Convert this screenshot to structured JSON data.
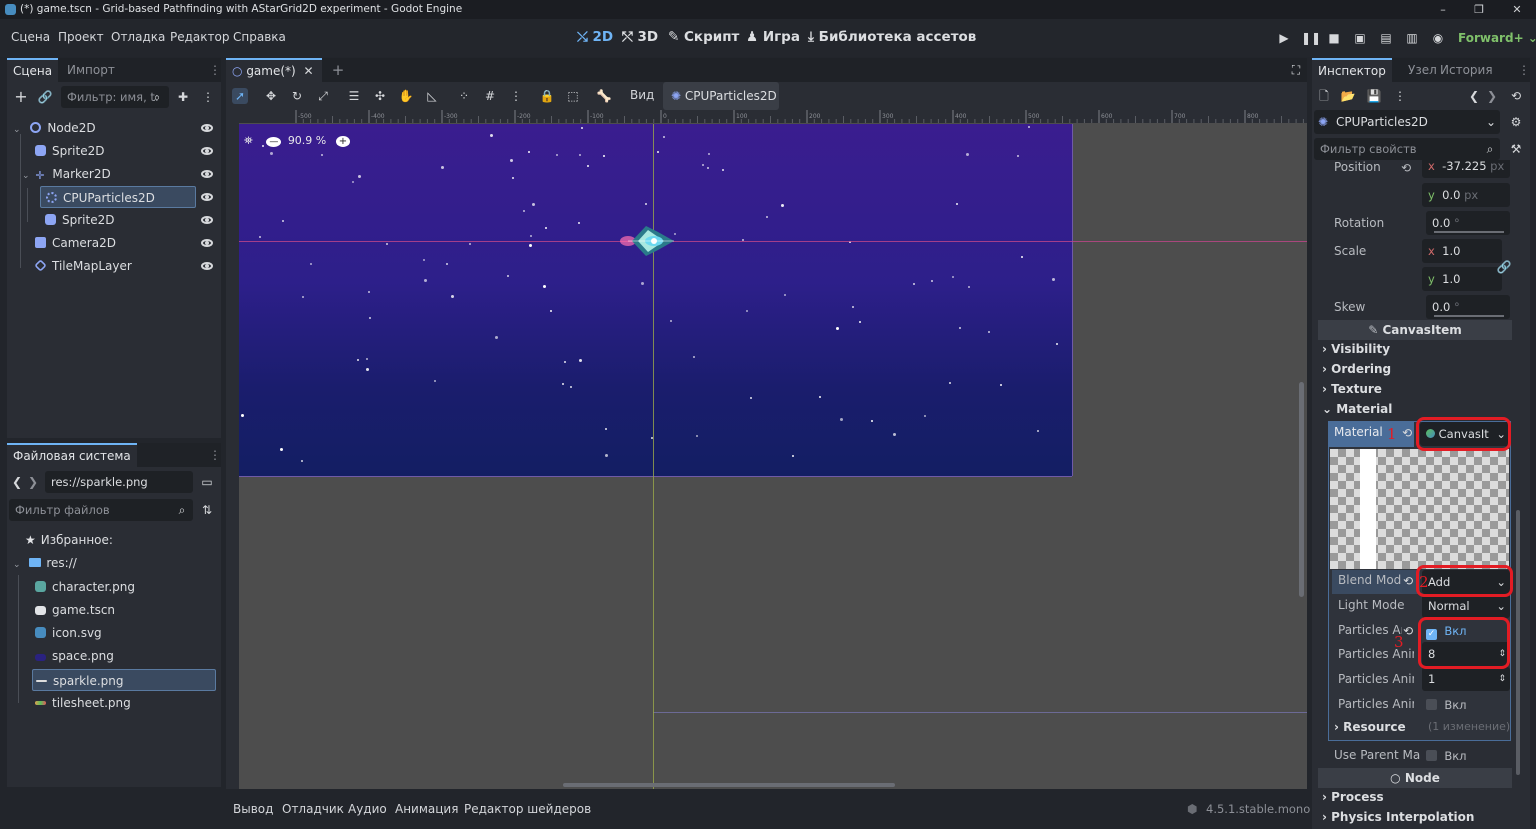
{
  "window": {
    "title": "(*) game.tscn - Grid-based Pathfinding with AStarGrid2D experiment - Godot Engine",
    "controls": [
      "–",
      "❐",
      "✕"
    ]
  },
  "menu": [
    "Сцена",
    "Проект",
    "Отладка",
    "Редактор",
    "Справка"
  ],
  "workspaces": {
    "w2d": "2D",
    "w3d": "3D",
    "script": "Скрипт",
    "game": "Игра",
    "assetlib": "Библиотека ассетов"
  },
  "renderer": "Forward+",
  "scene_dock": {
    "tabs": [
      "Сцена",
      "Импорт"
    ],
    "filter_placeholder": "Фильтр: имя, t:",
    "nodes": [
      {
        "name": "Node2D",
        "color": "#d6d8db"
      },
      {
        "name": "Sprite2D",
        "color": "#8da5f3"
      },
      {
        "name": "Marker2D",
        "color": "#8da5f3"
      },
      {
        "name": "CPUParticles2D",
        "color": "#8da5f3"
      },
      {
        "name": "Sprite2D",
        "color": "#8da5f3"
      },
      {
        "name": "Camera2D",
        "color": "#8da5f3"
      },
      {
        "name": "TileMapLayer",
        "color": "#8da5f3"
      }
    ]
  },
  "fs_dock": {
    "tab": "Файловая система",
    "path": "res://sparkle.png",
    "filter_placeholder": "Фильтр файлов",
    "favorites": "Избранное:",
    "root": "res://",
    "files": [
      "character.png",
      "game.tscn",
      "icon.svg",
      "space.png",
      "sparkle.png",
      "tilesheet.png"
    ]
  },
  "editor": {
    "scene_tab": "game(*)",
    "view_menu": "Вид",
    "context_node": "CPUParticles2D",
    "zoom": "90.9 %",
    "ruler_labels": [
      "-500",
      "-400",
      "-300",
      "-200",
      "-100",
      "0",
      "100",
      "200",
      "300",
      "400",
      "500",
      "600",
      "700",
      "800"
    ]
  },
  "bottom_panel": {
    "tabs": [
      "Вывод",
      "Отладчик",
      "Аудио",
      "Анимация",
      "Редактор шейдеров"
    ],
    "version": "4.5.1.stable.mono"
  },
  "inspector": {
    "tabs": [
      "Инспектор",
      "Узел",
      "История"
    ],
    "node": "CPUParticles2D",
    "filter_placeholder": "Фильтр свойств",
    "position": {
      "label": "Position",
      "x": "-37.225",
      "y": "0.0",
      "unit": "px"
    },
    "rotation": {
      "label": "Rotation",
      "value": "0.0",
      "unit": "°"
    },
    "scale": {
      "label": "Scale",
      "x": "1.0",
      "y": "1.0"
    },
    "skew": {
      "label": "Skew",
      "value": "0.0",
      "unit": "°"
    },
    "canvasitem": "CanvasItem",
    "sections": [
      "Visibility",
      "Ordering",
      "Texture",
      "Material"
    ],
    "material": {
      "label": "Material",
      "value": "CanvasIt"
    },
    "blend_mode": {
      "label": "Blend Mod",
      "value": "Add"
    },
    "light_mode": {
      "label": "Light Mode",
      "value": "Normal"
    },
    "particles_anim": {
      "label": "Particles An",
      "value": "Вкл"
    },
    "particles_h": {
      "label": "Particles Anim",
      "value": "8"
    },
    "particles_v": {
      "label": "Particles Anim",
      "value": "1"
    },
    "particles_loop": {
      "label": "Particles Anim",
      "value": "Вкл"
    },
    "resource": {
      "label": "Resource",
      "value": "(1 изменение)"
    },
    "use_parent": {
      "label": "Use Parent Mat",
      "value": "Вкл"
    },
    "node_section": "Node",
    "more_sections": [
      "Process",
      "Physics Interpolation"
    ],
    "annotations": [
      "1",
      "2",
      "3"
    ]
  },
  "colors": {
    "accent": "#6fb4f5",
    "highlight": "#e31c24",
    "sky_top": "#3a1d8f",
    "sky_bottom": "#131e63"
  }
}
